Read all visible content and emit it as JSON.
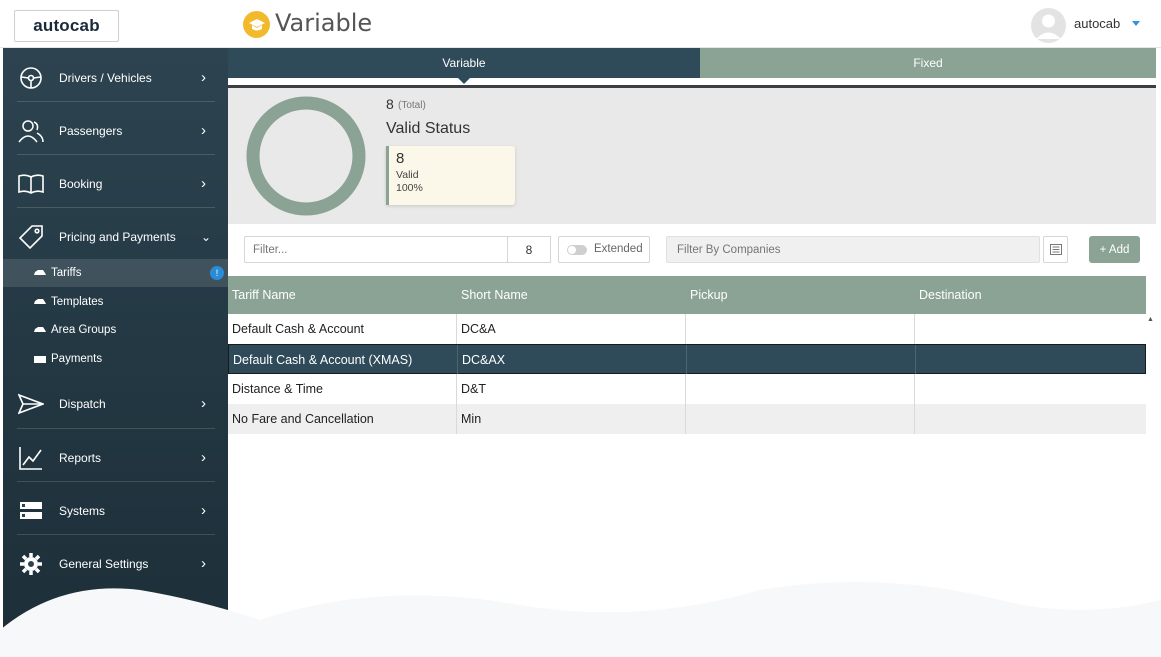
{
  "header": {
    "logo_text": "autocab",
    "page_title": "Variable",
    "user_name": "autocab"
  },
  "sidebar": {
    "items": [
      {
        "label": "Drivers / Vehicles",
        "icon": "steering-wheel-icon"
      },
      {
        "label": "Passengers",
        "icon": "people-icon"
      },
      {
        "label": "Booking",
        "icon": "book-icon"
      },
      {
        "label": "Pricing and Payments",
        "icon": "tag-icon",
        "expanded": true
      },
      {
        "label": "Dispatch",
        "icon": "paper-plane-icon"
      },
      {
        "label": "Reports",
        "icon": "chart-line-icon"
      },
      {
        "label": "Systems",
        "icon": "server-icon"
      },
      {
        "label": "General Settings",
        "icon": "gear-icon"
      }
    ],
    "sub_items": [
      {
        "label": "Tariffs",
        "active": true,
        "badge": "!"
      },
      {
        "label": "Templates"
      },
      {
        "label": "Area Groups"
      },
      {
        "label": "Payments"
      }
    ]
  },
  "tabs": [
    {
      "label": "Variable",
      "active": true
    },
    {
      "label": "Fixed",
      "active": false
    }
  ],
  "summary": {
    "total": "8",
    "total_label": "(Total)",
    "title": "Valid Status",
    "card": {
      "count": "8",
      "label": "Valid",
      "percent": "100%"
    },
    "valid_fraction": 1.0,
    "ring_color": "#8aa394"
  },
  "filter": {
    "placeholder": "Filter...",
    "count": "8",
    "extended_label": "Extended",
    "companies_placeholder": "Filter By Companies",
    "add_label": "+ Add"
  },
  "table": {
    "columns": [
      "Tariff Name",
      "Short Name",
      "Pickup",
      "Destination"
    ],
    "rows": [
      {
        "tariff_name": "Default Cash & Account",
        "short_name": "DC&A",
        "pickup": "",
        "destination": ""
      },
      {
        "tariff_name": "Default Cash & Account (XMAS)",
        "short_name": "DC&AX",
        "pickup": "",
        "destination": "",
        "selected": true
      },
      {
        "tariff_name": "Distance & Time",
        "short_name": "D&T",
        "pickup": "",
        "destination": ""
      },
      {
        "tariff_name": "No Fare and Cancellation",
        "short_name": "Min",
        "pickup": "",
        "destination": ""
      }
    ]
  },
  "colors": {
    "accent_green": "#8aa394",
    "sidebar_dark": "#2d4450",
    "selected_row": "#2f4a58",
    "badge_blue": "#2b8cd6",
    "title_icon": "#f2b92b"
  }
}
